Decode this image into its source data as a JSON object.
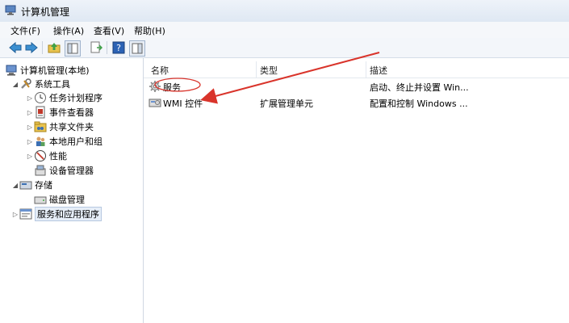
{
  "window": {
    "title": "计算机管理"
  },
  "menu": {
    "items": [
      "文件(F)",
      "操作(A)",
      "查看(V)",
      "帮助(H)"
    ]
  },
  "tree": [
    {
      "label": "计算机管理(本地)",
      "icon": "computer-mgmt-icon"
    },
    {
      "label": "系统工具",
      "icon": "tools-icon"
    },
    {
      "label": "任务计划程序",
      "icon": "clock-icon"
    },
    {
      "label": "事件查看器",
      "icon": "event-viewer-icon"
    },
    {
      "label": "共享文件夹",
      "icon": "shared-folder-icon"
    },
    {
      "label": "本地用户和组",
      "icon": "users-icon"
    },
    {
      "label": "性能",
      "icon": "performance-icon"
    },
    {
      "label": "设备管理器",
      "icon": "device-manager-icon"
    },
    {
      "label": "存储",
      "icon": "storage-icon"
    },
    {
      "label": "磁盘管理",
      "icon": "disk-icon"
    },
    {
      "label": "服务和应用程序",
      "icon": "services-apps-icon"
    }
  ],
  "table": {
    "columns": [
      "名称",
      "类型",
      "描述"
    ],
    "rows": [
      {
        "name": "服务",
        "type": "",
        "description": "启动、终止并设置 Win...",
        "icon": "gear-icon"
      },
      {
        "name": "WMI 控件",
        "type": "扩展管理单元",
        "description": "配置和控制 Windows ...",
        "icon": "wmi-icon"
      }
    ]
  },
  "colors": {
    "annotation": "#d9342b",
    "accent": "#3a6fb0"
  }
}
